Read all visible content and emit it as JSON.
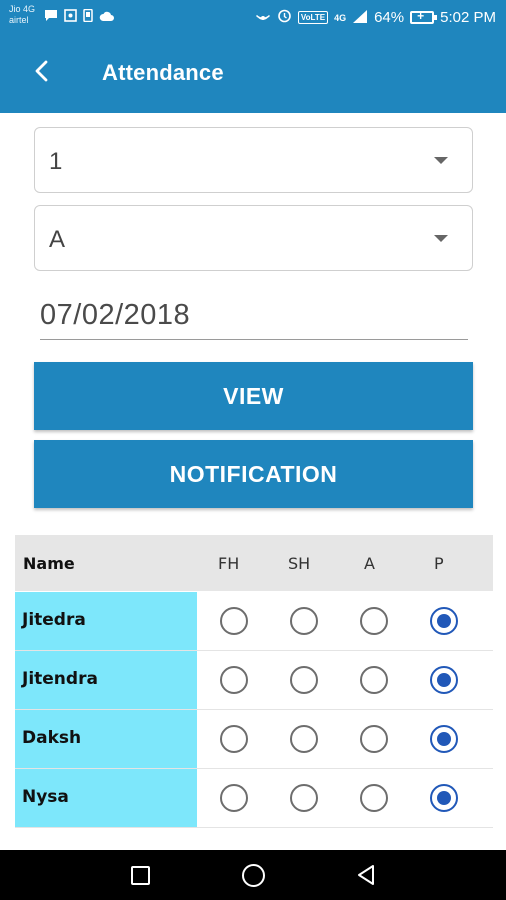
{
  "status_bar": {
    "carrier_line1": "Jio 4G",
    "carrier_line2": "airtel",
    "volte": "VoLTE",
    "network": "4G",
    "battery": "64%",
    "time": "5:02 PM"
  },
  "app_bar": {
    "title": "Attendance"
  },
  "form": {
    "class_value": "1",
    "section_value": "A",
    "date_value": "07/02/2018"
  },
  "buttons": {
    "view": "VIEW",
    "notification": "NOTIFICATION"
  },
  "table": {
    "headers": [
      "Name",
      "FH",
      "SH",
      "A",
      "P"
    ],
    "rows": [
      {
        "name": "Jitedra",
        "selected": "P"
      },
      {
        "name": "Jitendra",
        "selected": "P"
      },
      {
        "name": "Daksh",
        "selected": "P"
      },
      {
        "name": "Nysa",
        "selected": "P"
      }
    ]
  },
  "colors": {
    "primary": "#1f86be",
    "name_cell": "#7de7fb",
    "radio_selected": "#2158b8"
  }
}
